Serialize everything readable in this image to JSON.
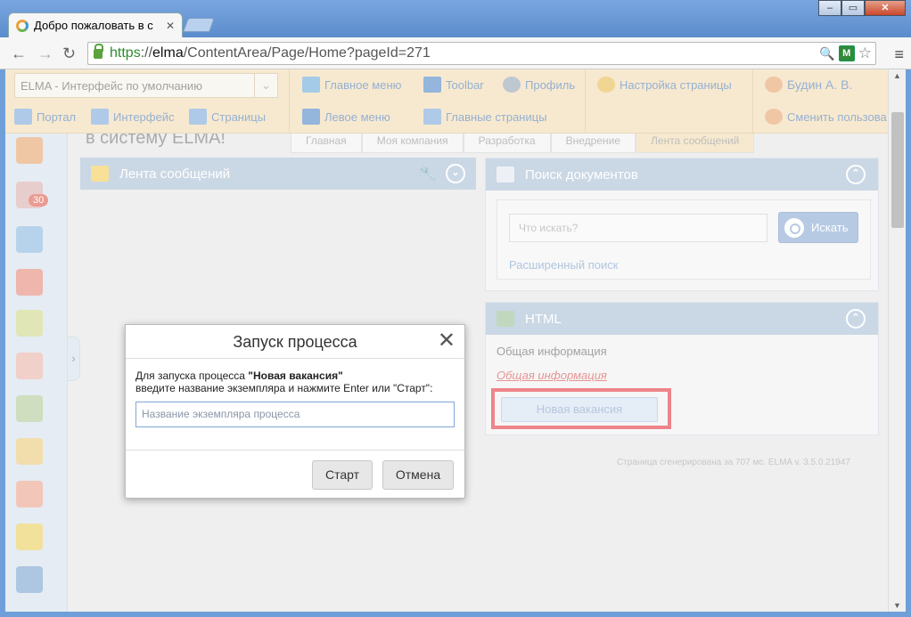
{
  "browser": {
    "tab_title": "Добро пожаловать в с",
    "tab_close": "✕",
    "url_scheme": "https",
    "url_host": "elma",
    "url_path": "/ContentArea/Page/Home?pageId=271",
    "url_prefix": "://",
    "back": "←",
    "forward": "→",
    "reload": "↻",
    "win_min": "–",
    "win_max": "▭",
    "win_close": "✕",
    "zoom": "🔍",
    "ext": "M",
    "star": "☆",
    "menu": "≡"
  },
  "toolbar": {
    "interface_select": "ELMA  - Интерфейс по умолчанию",
    "portal": "Портал",
    "interface": "Интерфейс",
    "pages": "Страницы",
    "main_menu": "Главное меню",
    "toolbar_label": "Toolbar",
    "profile": "Профиль",
    "page_settings": "Настройка страницы",
    "left_menu": "Левое меню",
    "main_pages": "Главные страницы",
    "user_name": "Будин А. В.",
    "change_user": "Сменить пользова"
  },
  "page": {
    "title": "в систему ELMA!",
    "tabs": [
      "Главная",
      "Моя компания",
      "Разработка",
      "Внедрение",
      "Лента сообщений"
    ],
    "footer_text": "Страница сгенерирована за 707 мс. ELMA v. 3.5.0.21947"
  },
  "rail": {
    "badge": "30",
    "toggle": "›"
  },
  "feed_portlet": {
    "title": "Лента сообщений"
  },
  "search_portlet": {
    "title": "Поиск документов",
    "placeholder": "Что искать?",
    "button": "Искать",
    "advanced": "Расширенный поиск"
  },
  "html_portlet": {
    "title": "HTML",
    "general_info": "Общая информация",
    "general_info_link": "Общая информация",
    "new_vacancy_button": "Новая вакансия"
  },
  "dialog": {
    "title": "Запуск процесса",
    "close": "✕",
    "text_prefix": "Для запуска процесса ",
    "process_name": "\"Новая вакансия\"",
    "text_rest": "введите название экземпляра и нажмите Enter или \"Старт\":",
    "input_placeholder": "Название экземпляра процесса",
    "start_button": "Старт",
    "cancel_button": "Отмена"
  },
  "scrollbar": {
    "up": "▲",
    "down": "▼"
  },
  "colors": {
    "accent": "#7d9fcc",
    "highlight_box": "#e0202a",
    "toolbar_band": "#f0d8a8",
    "link_red": "#d23b3b"
  }
}
